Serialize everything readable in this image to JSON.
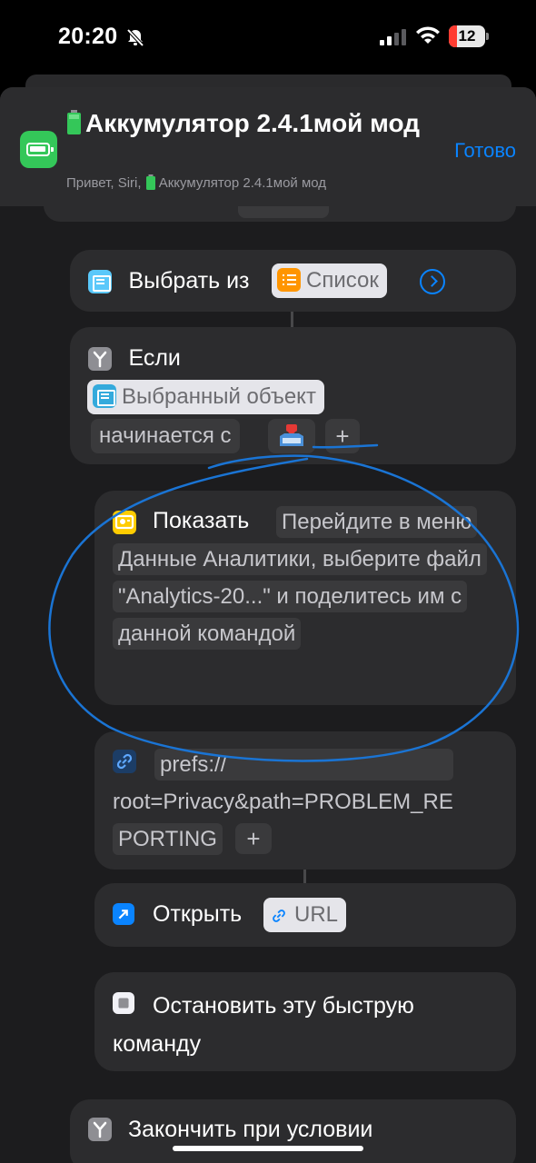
{
  "status_bar": {
    "time": "20:20",
    "battery_level": "12"
  },
  "header": {
    "title": "Аккумулятор 2.4.1мой мод",
    "subtitle_prefix": "Привет, Siri,",
    "subtitle_name": "Аккумулятор 2.4.1мой мод",
    "done_label": "Готово"
  },
  "actions": {
    "choose": {
      "label": "Выбрать из",
      "variable": "Список"
    },
    "if": {
      "label": "Если",
      "variable": "Выбранный объект",
      "condition": "начинается с",
      "add": "+"
    },
    "show": {
      "label": "Показать",
      "text": "Перейдите в меню Данные Аналитики, выберите файл \"Analytics-20...\" и поделитесь им с данной командой"
    },
    "url": {
      "line1": "prefs://",
      "line2": "root=Privacy&path=PROBLEM_RE",
      "line3": "PORTING",
      "add": "+"
    },
    "open": {
      "label": "Открыть",
      "variable": "URL"
    },
    "stop": {
      "label": "Остановить эту быструю команду"
    },
    "end_if": {
      "label": "Закончить при условии"
    }
  },
  "colors": {
    "accent": "#0a84ff",
    "app_icon": "#34c759",
    "annotation_stroke": "#1a74d4"
  }
}
